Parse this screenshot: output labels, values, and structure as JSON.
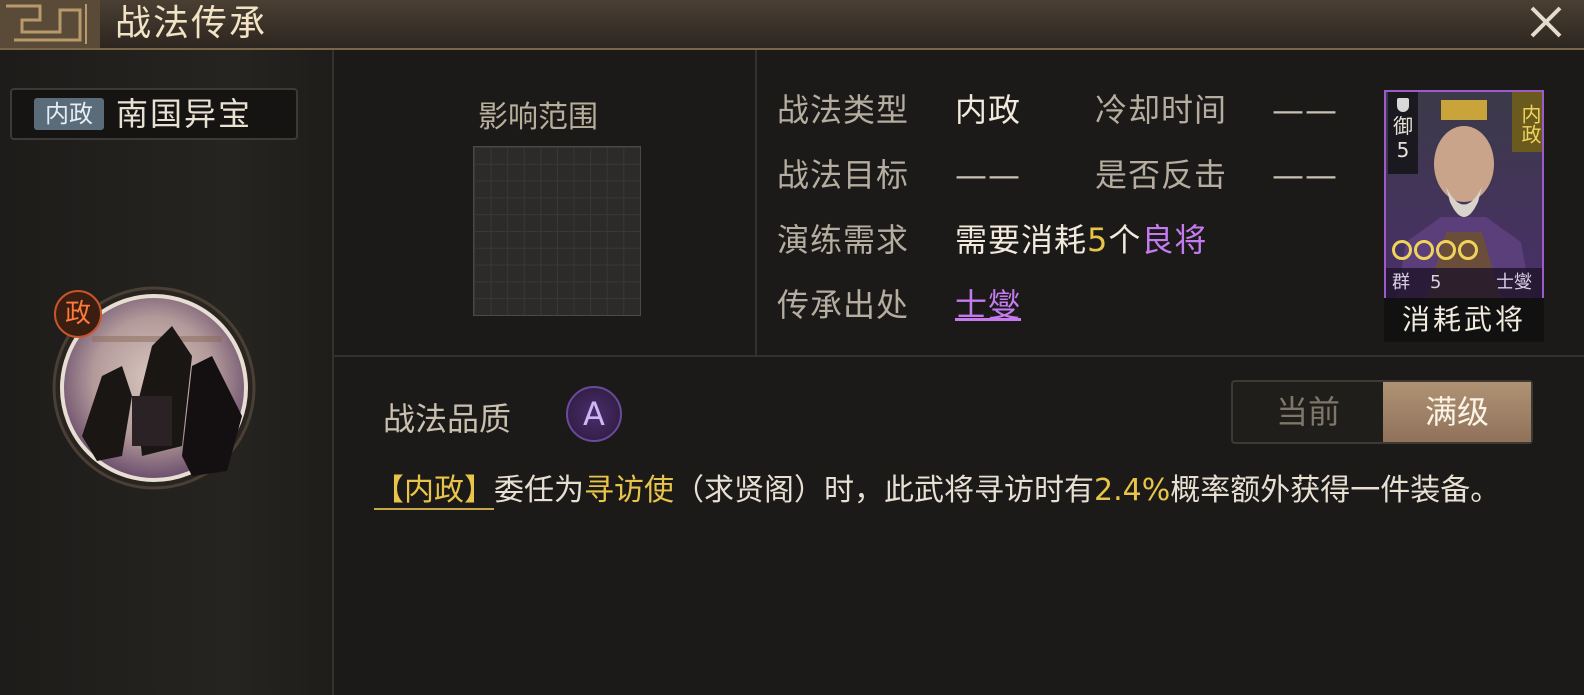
{
  "window": {
    "title": "战法传承"
  },
  "skill": {
    "category_badge": "内政",
    "name": "南国异宝",
    "medal_badge": "政"
  },
  "range": {
    "label": "影响范围"
  },
  "info": {
    "type_label": "战法类型",
    "type_value": "内政",
    "cooldown_label": "冷却时间",
    "cooldown_value": "——",
    "target_label": "战法目标",
    "target_value": "——",
    "counter_label": "是否反击",
    "counter_value": "——",
    "requirement_label": "演练需求",
    "requirement_prefix": "需要消耗",
    "requirement_count": "5",
    "requirement_unit": "个",
    "requirement_item": "良将",
    "source_label": "传承出处",
    "source_value": "士燮"
  },
  "general_card": {
    "troop_label": "御",
    "troop_num": "5",
    "skill_tag": "内政",
    "faction": "群",
    "cost": "5",
    "name": "士燮",
    "caption": "消耗武将"
  },
  "quality": {
    "label": "战法品质",
    "grade": "A"
  },
  "level_toggle": {
    "current_label": "当前",
    "max_label": "满级",
    "selected": "满级"
  },
  "description": {
    "tag": "【内政】",
    "part1": "委任为",
    "role": "寻访使",
    "part2": "（求贤阁）时，此武将寻访时有",
    "percent": "2.4%",
    "part3": "概率额外获得一件装备。"
  },
  "colors": {
    "accent_gold": "#e8c54a",
    "accent_purple": "#c47bf0",
    "panel_bg": "#1b1a18"
  }
}
